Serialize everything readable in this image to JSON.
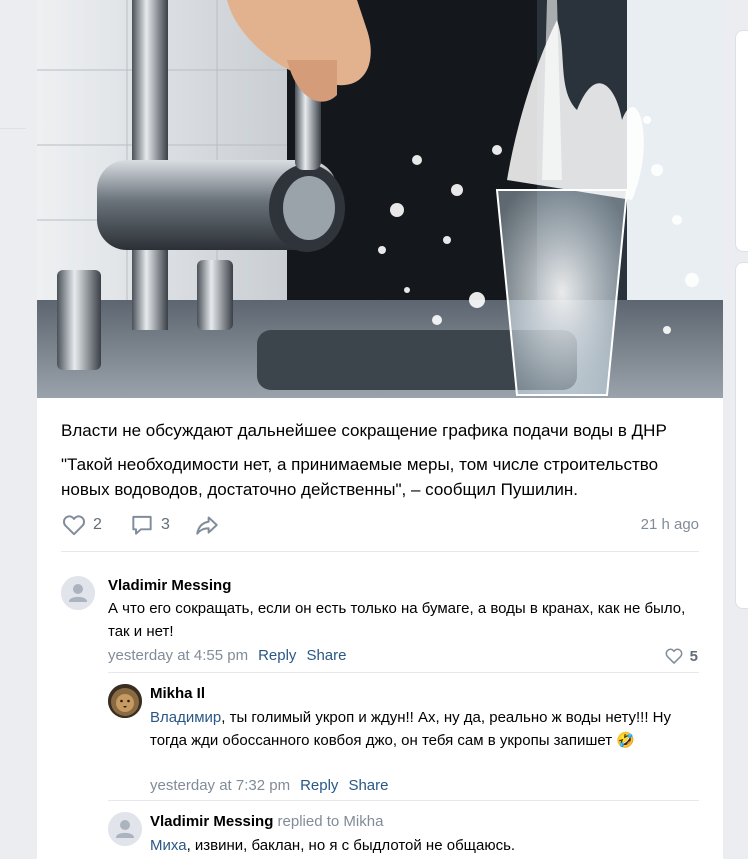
{
  "post": {
    "headline": "Власти не обсуждают дальнейшее сокращение графика подачи воды в ДНР",
    "quote": "\"Такой необходимости нет, а принимаемые меры, том числе строительство новых водоводов, достаточно действенны\", – сообщил Пушилин.",
    "likes": "2",
    "comments": "3",
    "time": "21 h ago",
    "image": "photo-tap-water-splash"
  },
  "comments": [
    {
      "author": "Vladimir Messing",
      "text": "А что его сокращать, если он есть только на бумаге, а воды в кранах, как не было, так и нет!",
      "time": "yesterday at 4:55 pm",
      "reply_label": "Reply",
      "share_label": "Share",
      "likes": "5"
    },
    {
      "author": "Mikha Il",
      "mention": "Владимир",
      "text": ", ты голимый укроп и ждун!! Ах, ну да, реально ж воды нету!!! Ну тогда жди обоссанного ковбоя джо, он тебя сам в укропы запишет",
      "emoji": "🤣",
      "time": "yesterday at 7:32 pm",
      "reply_label": "Reply",
      "share_label": "Share"
    },
    {
      "author": "Vladimir Messing",
      "replied_to": "replied to Mikha",
      "mention": "Миха",
      "text": ", извини, баклан, но я с быдлотой не общаюсь."
    }
  ],
  "colors": {
    "link": "#2a5885",
    "meta": "#818c99",
    "icon": "#818c99"
  }
}
